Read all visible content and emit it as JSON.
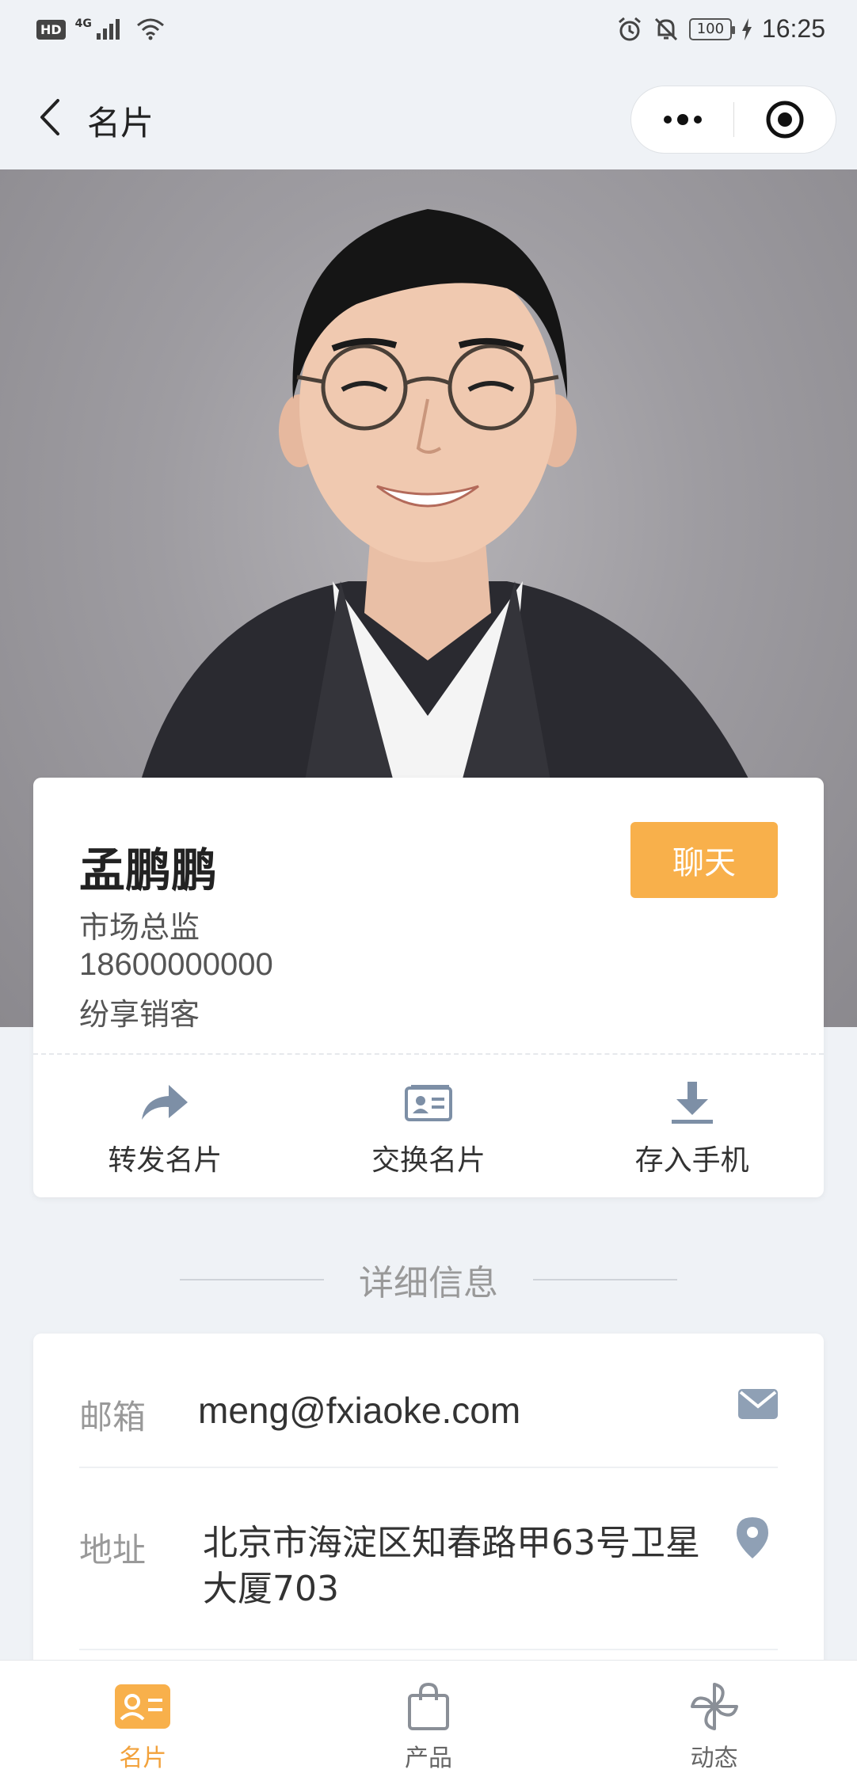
{
  "status_bar": {
    "network_badge": "HD",
    "network_type": "4G",
    "battery": "100",
    "time": "16:25"
  },
  "nav": {
    "title": "名片",
    "more_icon": "more-dots-icon",
    "close_icon": "target-close-icon"
  },
  "card": {
    "name": "孟鹏鹏",
    "title": "市场总监",
    "phone": "18600000000",
    "company": "纷享销客",
    "chat_label": "聊天",
    "actions": [
      {
        "icon": "share-arrow-icon",
        "label": "转发名片"
      },
      {
        "icon": "id-card-icon",
        "label": "交换名片"
      },
      {
        "icon": "download-icon",
        "label": "存入手机"
      }
    ]
  },
  "details": {
    "section_title": "详细信息",
    "email": {
      "label": "邮箱",
      "value": "meng@fxiaoke.com",
      "icon": "mail-icon"
    },
    "address": {
      "label": "地址",
      "value": "北京市海淀区知春路甲63号卫星大厦703",
      "icon": "location-pin-icon"
    }
  },
  "tabs": [
    {
      "icon": "card-icon",
      "label": "名片",
      "active": true
    },
    {
      "icon": "bag-icon",
      "label": "产品",
      "active": false
    },
    {
      "icon": "pinwheel-icon",
      "label": "动态",
      "active": false
    }
  ],
  "colors": {
    "accent": "#f8b04b",
    "icon_gray": "#7d8fa6",
    "background": "#eff2f6"
  }
}
